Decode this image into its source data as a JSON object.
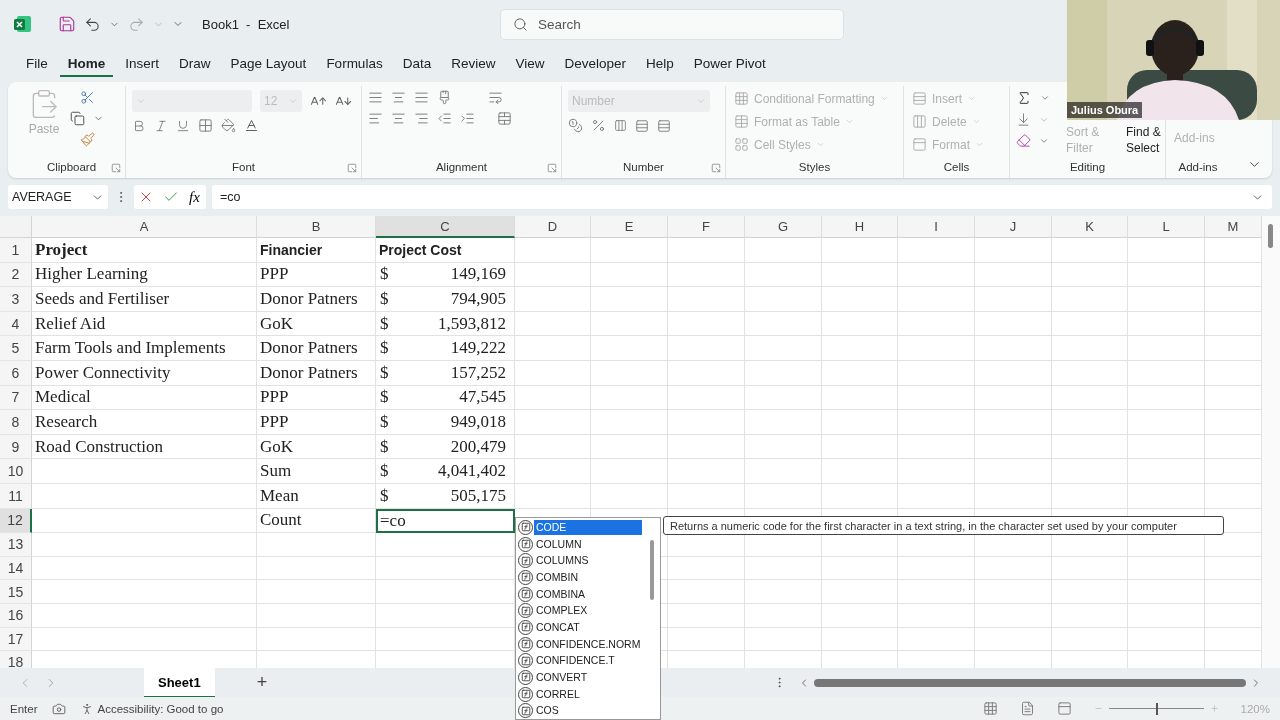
{
  "title_bar": {
    "title": "Book1  -  Excel",
    "search": {
      "placeholder": "Search"
    }
  },
  "menu_tabs": [
    {
      "label": "File",
      "selected": false
    },
    {
      "label": "Home",
      "selected": true
    },
    {
      "label": "Insert",
      "selected": false
    },
    {
      "label": "Draw",
      "selected": false
    },
    {
      "label": "Page Layout",
      "selected": false
    },
    {
      "label": "Formulas",
      "selected": false
    },
    {
      "label": "Data",
      "selected": false
    },
    {
      "label": "Review",
      "selected": false
    },
    {
      "label": "View",
      "selected": false
    },
    {
      "label": "Developer",
      "selected": false
    },
    {
      "label": "Help",
      "selected": false
    },
    {
      "label": "Power Pivot",
      "selected": false
    }
  ],
  "ribbon": {
    "clipboard": {
      "label": "Clipboard",
      "paste": {
        "label": "Paste",
        "disabled": true
      }
    },
    "font": {
      "label": "Font",
      "size": {
        "value": "12",
        "disabled": true
      }
    },
    "alignment": {
      "label": "Alignment"
    },
    "number": {
      "label": "Number",
      "format": {
        "value": "Number",
        "disabled": true
      }
    },
    "styles": {
      "label": "Styles",
      "commands": [
        {
          "label": "Conditional Formatting",
          "disabled": true
        },
        {
          "label": "Format as Table",
          "disabled": true
        },
        {
          "label": "Cell Styles",
          "disabled": true
        }
      ]
    },
    "cells": {
      "label": "Cells",
      "commands": [
        {
          "label": "Insert",
          "disabled": true
        },
        {
          "label": "Delete",
          "disabled": true
        },
        {
          "label": "Format",
          "disabled": true
        }
      ]
    },
    "editing": {
      "label": "Editing",
      "commands": [
        {
          "label": "Sort & Filter",
          "disabled": true
        },
        {
          "label": "Find & Select",
          "disabled": false
        }
      ]
    },
    "addins": {
      "label": "Add-ins",
      "commands": [
        {
          "label": "Add-ins",
          "disabled": true
        }
      ]
    }
  },
  "formula_bar": {
    "name_box": "AVERAGE",
    "function_button": "fx",
    "formula": "=co"
  },
  "sheet": {
    "columns": [
      {
        "label": "A",
        "selected": false
      },
      {
        "label": "B",
        "selected": false
      },
      {
        "label": "C",
        "selected": true
      },
      {
        "label": "D",
        "selected": false
      },
      {
        "label": "E",
        "selected": false
      },
      {
        "label": "F",
        "selected": false
      },
      {
        "label": "G",
        "selected": false
      },
      {
        "label": "H",
        "selected": false
      },
      {
        "label": "I",
        "selected": false
      },
      {
        "label": "J",
        "selected": false
      },
      {
        "label": "K",
        "selected": false
      },
      {
        "label": "L",
        "selected": false
      },
      {
        "label": "M",
        "selected": false
      }
    ],
    "rows": [
      {
        "number": "1",
        "selected": false,
        "cells": [
          {
            "kind": "title",
            "text": "Project"
          },
          {
            "kind": "heading",
            "text": "Financier"
          },
          {
            "kind": "heading",
            "text": "Project Cost"
          }
        ]
      },
      {
        "number": "2",
        "selected": false,
        "cells": [
          {
            "kind": "text",
            "text": "Higher Learning"
          },
          {
            "kind": "text",
            "text": "PPP"
          },
          {
            "kind": "currency",
            "symbol": "$",
            "value": "149,169"
          }
        ]
      },
      {
        "number": "3",
        "selected": false,
        "cells": [
          {
            "kind": "text",
            "text": "Seeds and Fertiliser"
          },
          {
            "kind": "text",
            "text": "Donor Patners"
          },
          {
            "kind": "currency",
            "symbol": "$",
            "value": "794,905"
          }
        ]
      },
      {
        "number": "4",
        "selected": false,
        "cells": [
          {
            "kind": "text",
            "text": "Relief Aid"
          },
          {
            "kind": "text",
            "text": "GoK"
          },
          {
            "kind": "currency",
            "symbol": "$",
            "value": "1,593,812"
          }
        ]
      },
      {
        "number": "5",
        "selected": false,
        "cells": [
          {
            "kind": "text",
            "text": "Farm Tools and Implements"
          },
          {
            "kind": "text",
            "text": "Donor Patners"
          },
          {
            "kind": "currency",
            "symbol": "$",
            "value": "149,222"
          }
        ]
      },
      {
        "number": "6",
        "selected": false,
        "cells": [
          {
            "kind": "text",
            "text": "Power Connectivity"
          },
          {
            "kind": "text",
            "text": "Donor Patners"
          },
          {
            "kind": "currency",
            "symbol": "$",
            "value": "157,252"
          }
        ]
      },
      {
        "number": "7",
        "selected": false,
        "cells": [
          {
            "kind": "text",
            "text": "Medical"
          },
          {
            "kind": "text",
            "text": "PPP"
          },
          {
            "kind": "currency",
            "symbol": "$",
            "value": "47,545"
          }
        ]
      },
      {
        "number": "8",
        "selected": false,
        "cells": [
          {
            "kind": "text",
            "text": "Research"
          },
          {
            "kind": "text",
            "text": "PPP"
          },
          {
            "kind": "currency",
            "symbol": "$",
            "value": "949,018"
          }
        ]
      },
      {
        "number": "9",
        "selected": false,
        "cells": [
          {
            "kind": "text",
            "text": "Road Construction"
          },
          {
            "kind": "text",
            "text": "GoK"
          },
          {
            "kind": "currency",
            "symbol": "$",
            "value": "200,479"
          }
        ]
      },
      {
        "number": "10",
        "selected": false,
        "cells": [
          null,
          {
            "kind": "text",
            "text": "Sum"
          },
          {
            "kind": "currency",
            "symbol": "$",
            "value": "4,041,402"
          }
        ]
      },
      {
        "number": "11",
        "selected": false,
        "cells": [
          null,
          {
            "kind": "text",
            "text": "Mean"
          },
          {
            "kind": "currency",
            "symbol": "$",
            "value": "505,175"
          }
        ]
      },
      {
        "number": "12",
        "selected": true,
        "cells": [
          null,
          {
            "kind": "text",
            "text": "Count"
          },
          {
            "kind": "editing",
            "text": "=co"
          }
        ]
      },
      {
        "number": "13",
        "selected": false
      },
      {
        "number": "14",
        "selected": false
      },
      {
        "number": "15",
        "selected": false
      },
      {
        "number": "16",
        "selected": false
      },
      {
        "number": "17",
        "selected": false
      },
      {
        "number": "18",
        "selected": false
      }
    ]
  },
  "autocomplete": {
    "items": [
      {
        "label": "CODE",
        "selected": true
      },
      {
        "label": "COLUMN",
        "selected": false
      },
      {
        "label": "COLUMNS",
        "selected": false
      },
      {
        "label": "COMBIN",
        "selected": false
      },
      {
        "label": "COMBINA",
        "selected": false
      },
      {
        "label": "COMPLEX",
        "selected": false
      },
      {
        "label": "CONCAT",
        "selected": false
      },
      {
        "label": "CONFIDENCE.NORM",
        "selected": false
      },
      {
        "label": "CONFIDENCE.T",
        "selected": false
      },
      {
        "label": "CONVERT",
        "selected": false
      },
      {
        "label": "CORREL",
        "selected": false
      },
      {
        "label": "COS",
        "selected": false
      }
    ],
    "tooltip": "Returns a numeric code for the first character in a text string, in the character set used by your computer"
  },
  "sheet_tabs": {
    "tabs": [
      {
        "label": "Sheet1",
        "selected": true
      }
    ],
    "add_button": "+"
  },
  "status_bar": {
    "mode": "Enter",
    "accessibility": "Accessibility: Good to go",
    "zoom": {
      "level": 0.5,
      "label": "120%"
    }
  },
  "webcam": {
    "kind": "picture",
    "caption": "Julius Obura"
  }
}
